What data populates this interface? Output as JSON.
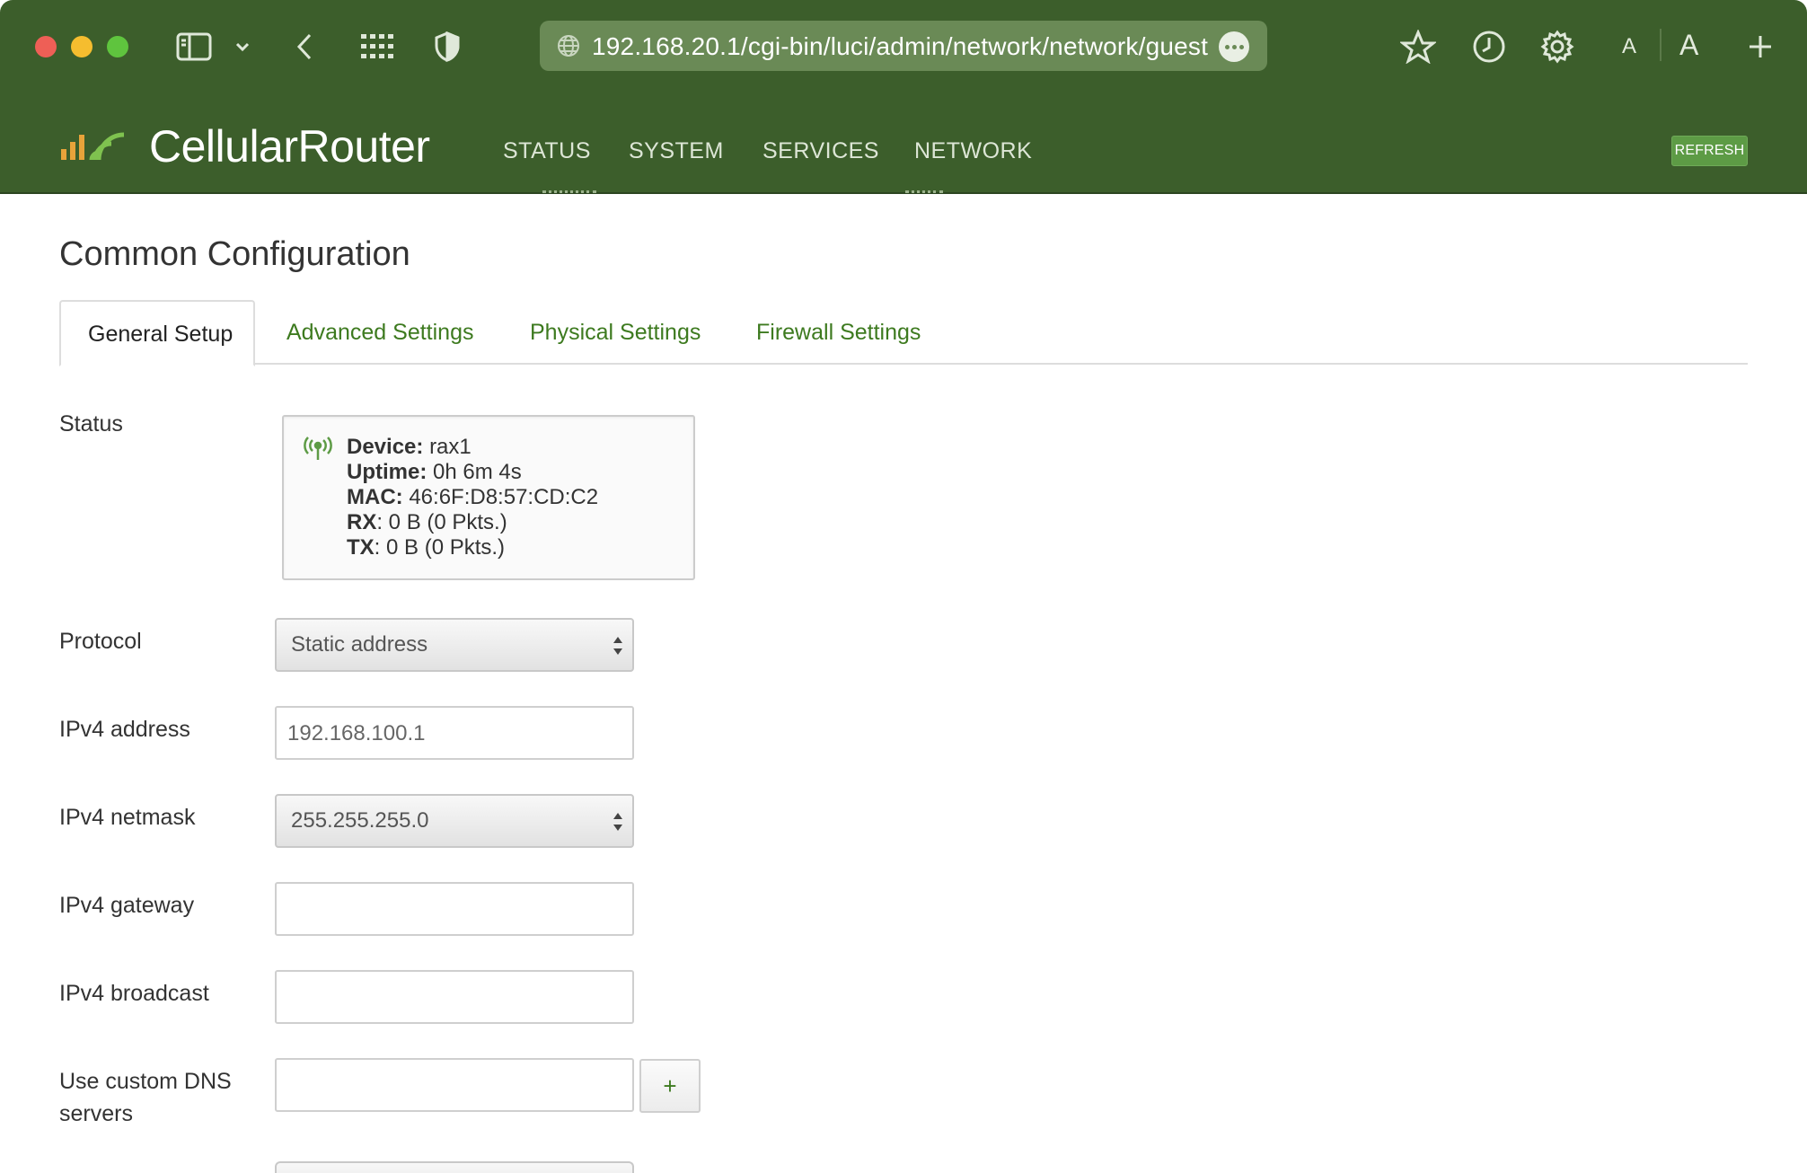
{
  "browser": {
    "url": "192.168.20.1/cgi-bin/luci/admin/network/network/guest",
    "font_small": "A",
    "font_large": "A"
  },
  "header": {
    "brand": "CellularRouter",
    "nav": [
      "STATUS",
      "SYSTEM",
      "SERVICES",
      "NETWORK"
    ],
    "refresh_label": "REFRESH"
  },
  "page": {
    "title": "Common Configuration",
    "tabs": [
      "General Setup",
      "Advanced Settings",
      "Physical Settings",
      "Firewall Settings"
    ],
    "active_tab": "General Setup"
  },
  "status": {
    "label": "Status",
    "device_key": "Device:",
    "device": "rax1",
    "uptime_key": "Uptime:",
    "uptime": "0h 6m 4s",
    "mac_key": "MAC:",
    "mac": "46:6F:D8:57:CD:C2",
    "rx_key": "RX",
    "rx": ": 0 B (0 Pkts.)",
    "tx_key": "TX",
    "tx": ": 0 B (0 Pkts.)"
  },
  "form": {
    "protocol_label": "Protocol",
    "protocol_value": "Static address",
    "ipv4_address_label": "IPv4 address",
    "ipv4_address_value": "192.168.100.1",
    "ipv4_netmask_label": "IPv4 netmask",
    "ipv4_netmask_value": "255.255.255.0",
    "ipv4_gateway_label": "IPv4 gateway",
    "ipv4_gateway_value": "",
    "ipv4_broadcast_label": "IPv4 broadcast",
    "ipv4_broadcast_value": "",
    "dns_label_line1": "Use custom DNS",
    "dns_label_line2": "servers",
    "dns_value": "",
    "add_dns_label": "+"
  },
  "colors": {
    "brand_green": "#3c5e2b",
    "accent_green": "#3d7a1f",
    "refresh_green": "#5d9b45",
    "signal_orange": "#e8a33a"
  }
}
